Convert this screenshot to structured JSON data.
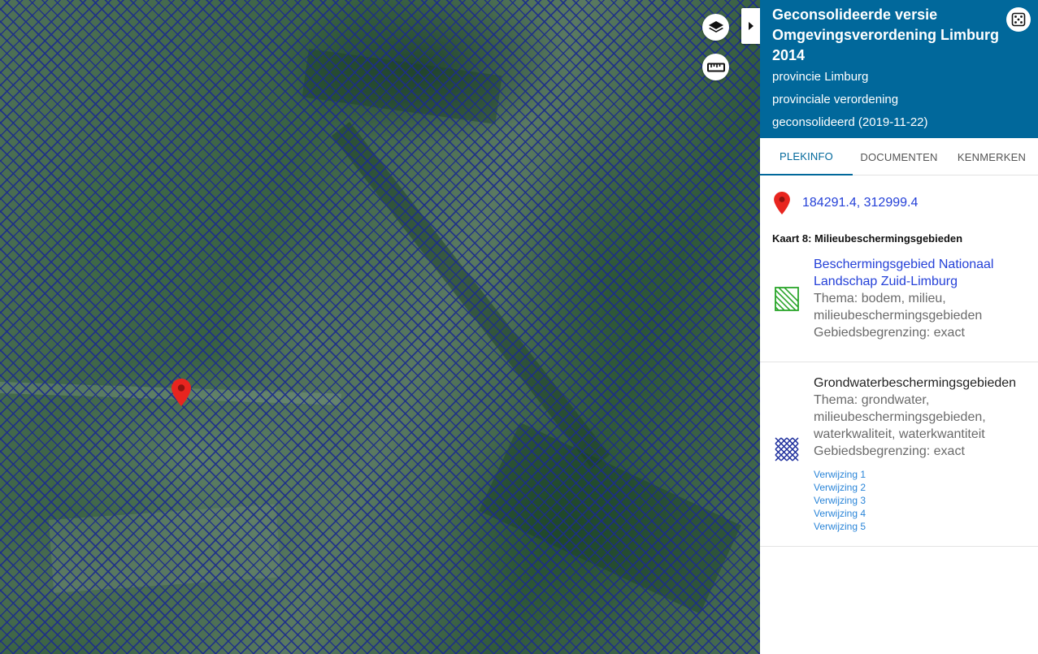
{
  "map": {
    "layers_icon": "layers-icon",
    "measure_icon": "ruler-icon",
    "toggle_icon": "caret-right-icon",
    "marker_icon": "map-pin-icon",
    "marker_color": "#e8251f",
    "hatch_color": "#1c2d8c"
  },
  "panel": {
    "title": "Geconsolideerde versie Omgevingsverordening Limburg 2014",
    "authority": "provincie Limburg",
    "doc_type": "provinciale verordening",
    "status": "geconsolideerd (2019-11-22)",
    "expand_icon": "expand-icon",
    "header_color": "#01689b",
    "tabs": [
      {
        "label": "PLEKINFO",
        "active": true
      },
      {
        "label": "DOCUMENTEN",
        "active": false
      },
      {
        "label": "KENMERKEN",
        "active": false
      }
    ],
    "coordinates": "184291.4, 312999.4",
    "section_title": "Kaart 8: Milieubeschermingsgebieden",
    "features": [
      {
        "name": "Beschermingsgebied Nationaal Landschap Zuid-Limburg",
        "theme": "Thema: bodem, milieu, milieubeschermingsgebieden",
        "boundary": "Gebiedsbegrenzing: exact",
        "icon": "diagonal-hatch-green-icon"
      },
      {
        "name": "Grondwaterbeschermingsgebieden",
        "theme": "Thema: grondwater, milieubeschermingsgebieden, waterkwaliteit, waterkwantiteit",
        "boundary": "Gebiedsbegrenzing: exact",
        "icon": "cross-hatch-blue-icon",
        "references": [
          "Verwijzing 1",
          "Verwijzing 2",
          "Verwijzing 3",
          "Verwijzing 4",
          "Verwijzing 5"
        ]
      }
    ]
  }
}
